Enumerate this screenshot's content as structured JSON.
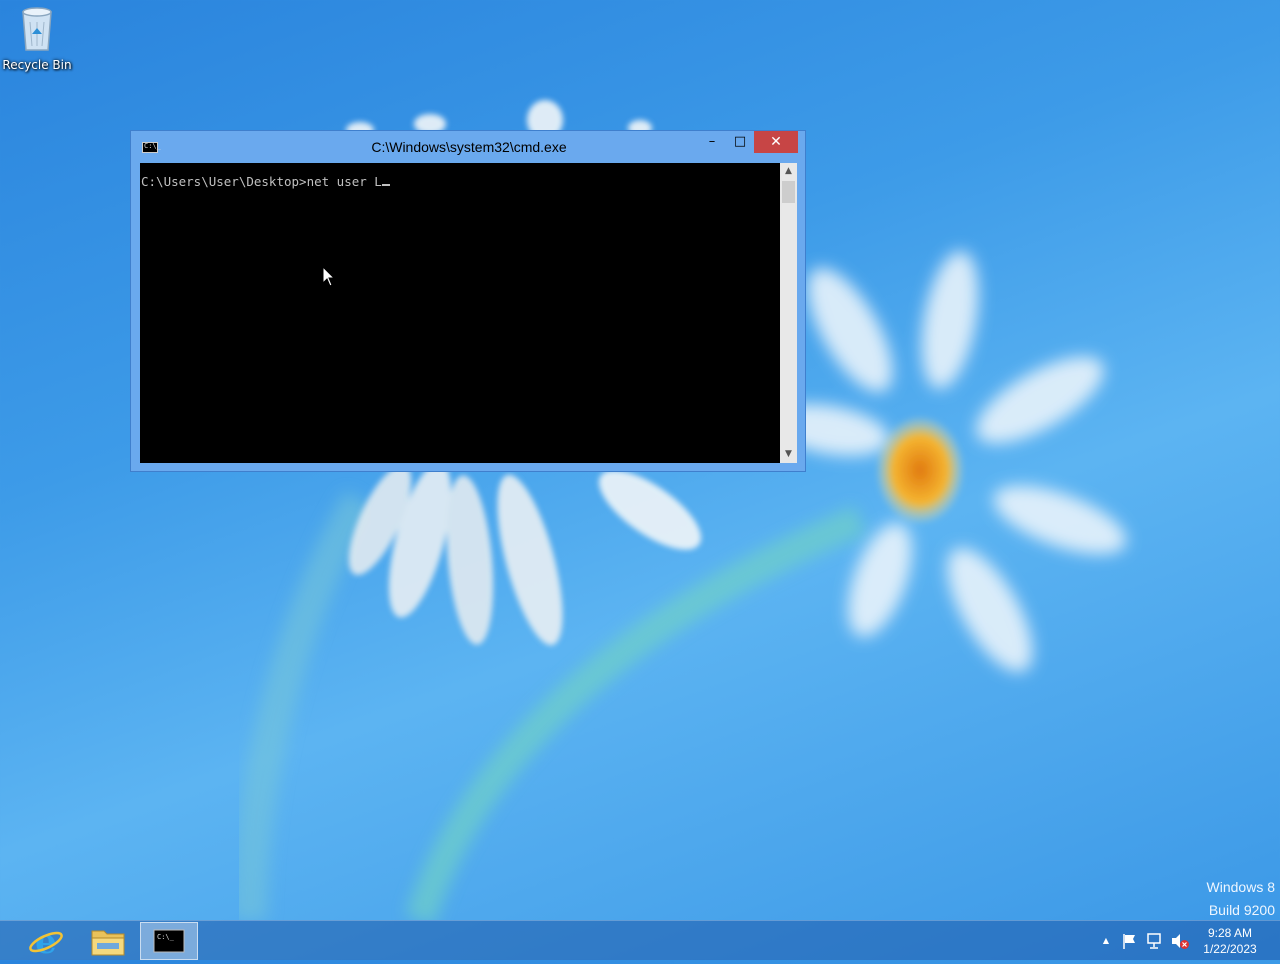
{
  "desktop": {
    "icons": [
      {
        "label": "Recycle Bin",
        "icon": "recycle-bin-icon"
      }
    ],
    "watermark": {
      "line1": "Windows 8",
      "line2": "Build 9200"
    }
  },
  "cmd_window": {
    "title": "C:\\Windows\\system32\\cmd.exe",
    "icon": "cmd-icon",
    "icon_text": "C:\\_",
    "buttons": {
      "minimize": "–",
      "maximize": "□",
      "close": "✕"
    },
    "console": {
      "prompt": "C:\\Users\\User\\Desktop>",
      "command": "net user L"
    },
    "scrollbar": {
      "up": "▲",
      "down": "▼"
    }
  },
  "taskbar": {
    "apps": [
      {
        "name": "Internet Explorer",
        "icon": "internet-explorer-icon"
      },
      {
        "name": "File Explorer",
        "icon": "file-explorer-icon"
      },
      {
        "name": "Command Prompt",
        "icon": "cmd-icon",
        "active": true
      }
    ],
    "tray": {
      "show_hidden": "▲",
      "icons": [
        "action-center-flag-icon",
        "network-icon",
        "volume-muted-icon"
      ]
    },
    "clock": {
      "time": "9:28 AM",
      "date": "1/22/2023"
    }
  },
  "colors": {
    "titlebar": "#6aa9ee",
    "close_button": "#c74545",
    "console_bg": "#000000",
    "console_text": "#c0c0c0"
  }
}
